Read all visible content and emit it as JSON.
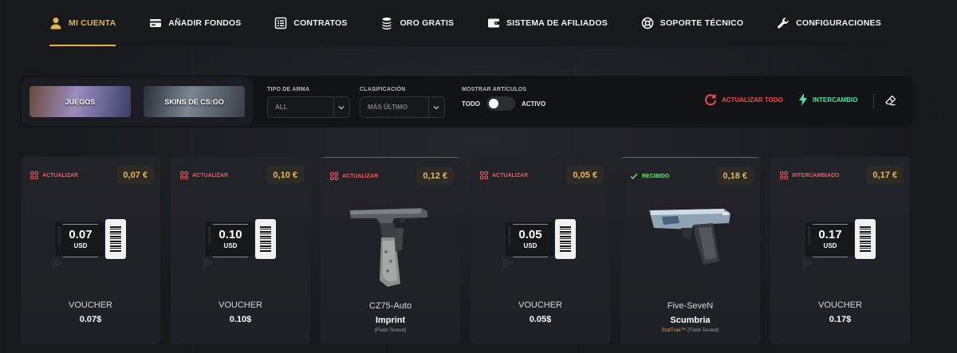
{
  "nav": {
    "items": [
      {
        "label": "MI CUENTA",
        "icon": "user-icon",
        "active": true
      },
      {
        "label": "AÑADIR FONDOS",
        "icon": "card-icon"
      },
      {
        "label": "CONTRATOS",
        "icon": "list-icon"
      },
      {
        "label": "ORO GRATIS",
        "icon": "coins-icon"
      },
      {
        "label": "SISTEMA DE AFILIADOS",
        "icon": "wallet-icon"
      },
      {
        "label": "SOPORTE TÉCNICO",
        "icon": "lifebuoy-icon"
      },
      {
        "label": "CONFIGURACIONES",
        "icon": "wrench-icon"
      }
    ]
  },
  "filters": {
    "games": [
      "JUEGOS",
      "SKINS DE CS:GO"
    ],
    "weapon_type": {
      "label": "TIPO DE ARMA",
      "value": "ALL"
    },
    "sort": {
      "label": "CLASIFICACIÓN",
      "value": "MÁS ÚLTIMO"
    },
    "show_items": {
      "label": "MOSTRAR ARTÍCULOS",
      "left": "TODO",
      "right": "ACTIVO"
    },
    "refresh_all": "ACTUALIZAR TODO",
    "exchange": "INTERCAMBIO"
  },
  "accent_color": "#e5b54c",
  "cards": [
    {
      "status": "ACTUALIZAR",
      "status_type": "refresh",
      "price": "0,07 €",
      "kind": "voucher",
      "amount": "0.07",
      "currency": "USD",
      "voucher_side": "VOUCHER",
      "title": "VOUCHER",
      "subtitle": "0.07$"
    },
    {
      "status": "ACTUALIZAR",
      "status_type": "refresh",
      "price": "0,10 €",
      "kind": "voucher",
      "amount": "0.10",
      "currency": "USD",
      "voucher_side": "VOUCHER",
      "title": "VOUCHER",
      "subtitle": "0.10$"
    },
    {
      "status": "ACTUALIZAR",
      "status_type": "refresh",
      "price": "0,12 €",
      "kind": "gun",
      "gun": "cz75",
      "title": "CZ75-Auto",
      "subtitle": "Imprint",
      "wear": "(Field-Tested)"
    },
    {
      "status": "ACTUALIZAR",
      "status_type": "refresh",
      "price": "0,05 €",
      "kind": "voucher",
      "amount": "0.05",
      "currency": "USD",
      "voucher_side": "VOUCHER",
      "title": "VOUCHER",
      "subtitle": "0.05$"
    },
    {
      "status": "RECIBIDO",
      "status_type": "received",
      "price": "0,18 €",
      "kind": "gun",
      "gun": "fiveseven",
      "title": "Five-SeveN",
      "subtitle": "Scumbria",
      "stattrak": "StatTrak™",
      "wear": "(Field-Tested)"
    },
    {
      "status": "INTERCAMBIADO",
      "status_type": "exchanged",
      "price": "0,17 €",
      "kind": "voucher",
      "amount": "0.17",
      "currency": "USD",
      "voucher_side": "VOUCHER",
      "title": "VOUCHER",
      "subtitle": "0.17$"
    }
  ]
}
